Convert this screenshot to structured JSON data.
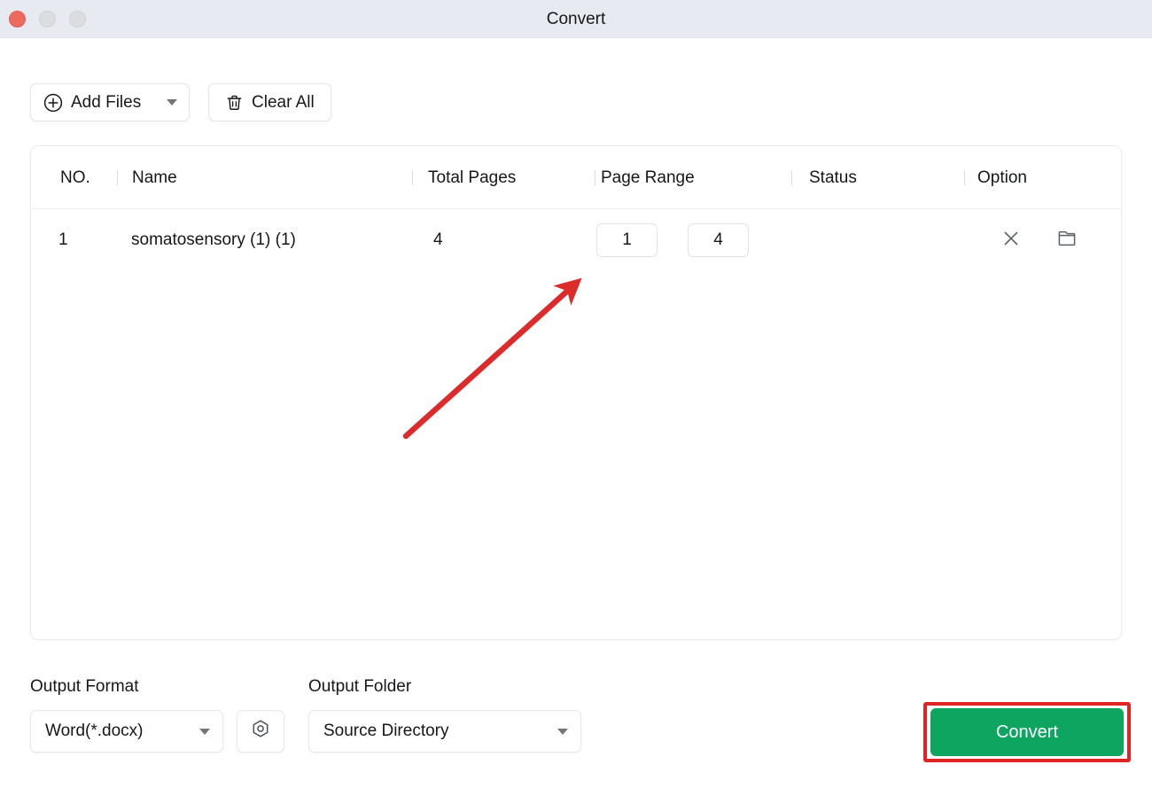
{
  "window": {
    "title": "Convert",
    "controls": {
      "close": "close-button",
      "minimize": "minimize-button",
      "maximize": "maximize-button"
    }
  },
  "toolbar": {
    "add_files_label": "Add Files",
    "add_files_icon": "plus-circle-icon",
    "add_files_caret": "chevron-down-icon",
    "clear_all_label": "Clear All",
    "clear_all_icon": "trash-icon"
  },
  "table": {
    "headers": {
      "no": "NO.",
      "name": "Name",
      "total_pages": "Total Pages",
      "page_range": "Page Range",
      "status": "Status",
      "option": "Option"
    },
    "rows": [
      {
        "no": "1",
        "name": "somatosensory (1) (1)",
        "total_pages": "4",
        "page_from": "1",
        "page_dash": "–",
        "page_to": "4",
        "status": "",
        "remove_icon": "close-icon",
        "folder_icon": "folder-icon"
      }
    ]
  },
  "footer": {
    "output_format_label": "Output Format",
    "output_format_value": "Word(*.docx)",
    "settings_icon": "hex-nut-settings-icon",
    "output_folder_label": "Output Folder",
    "output_folder_value": "Source Directory",
    "convert_label": "Convert"
  },
  "annotation": {
    "arrow": "red-arrow-annotation",
    "highlight": "red-highlight-box",
    "arrow_color": "#e02424",
    "highlight_color": "#e02424"
  },
  "colors": {
    "titlebar_bg": "#e8eaf1",
    "accent_green": "#0ea561",
    "annotation_red": "#e02424",
    "close_dot": "#ec6a5e",
    "inactive_dot": "#dcdde1"
  }
}
